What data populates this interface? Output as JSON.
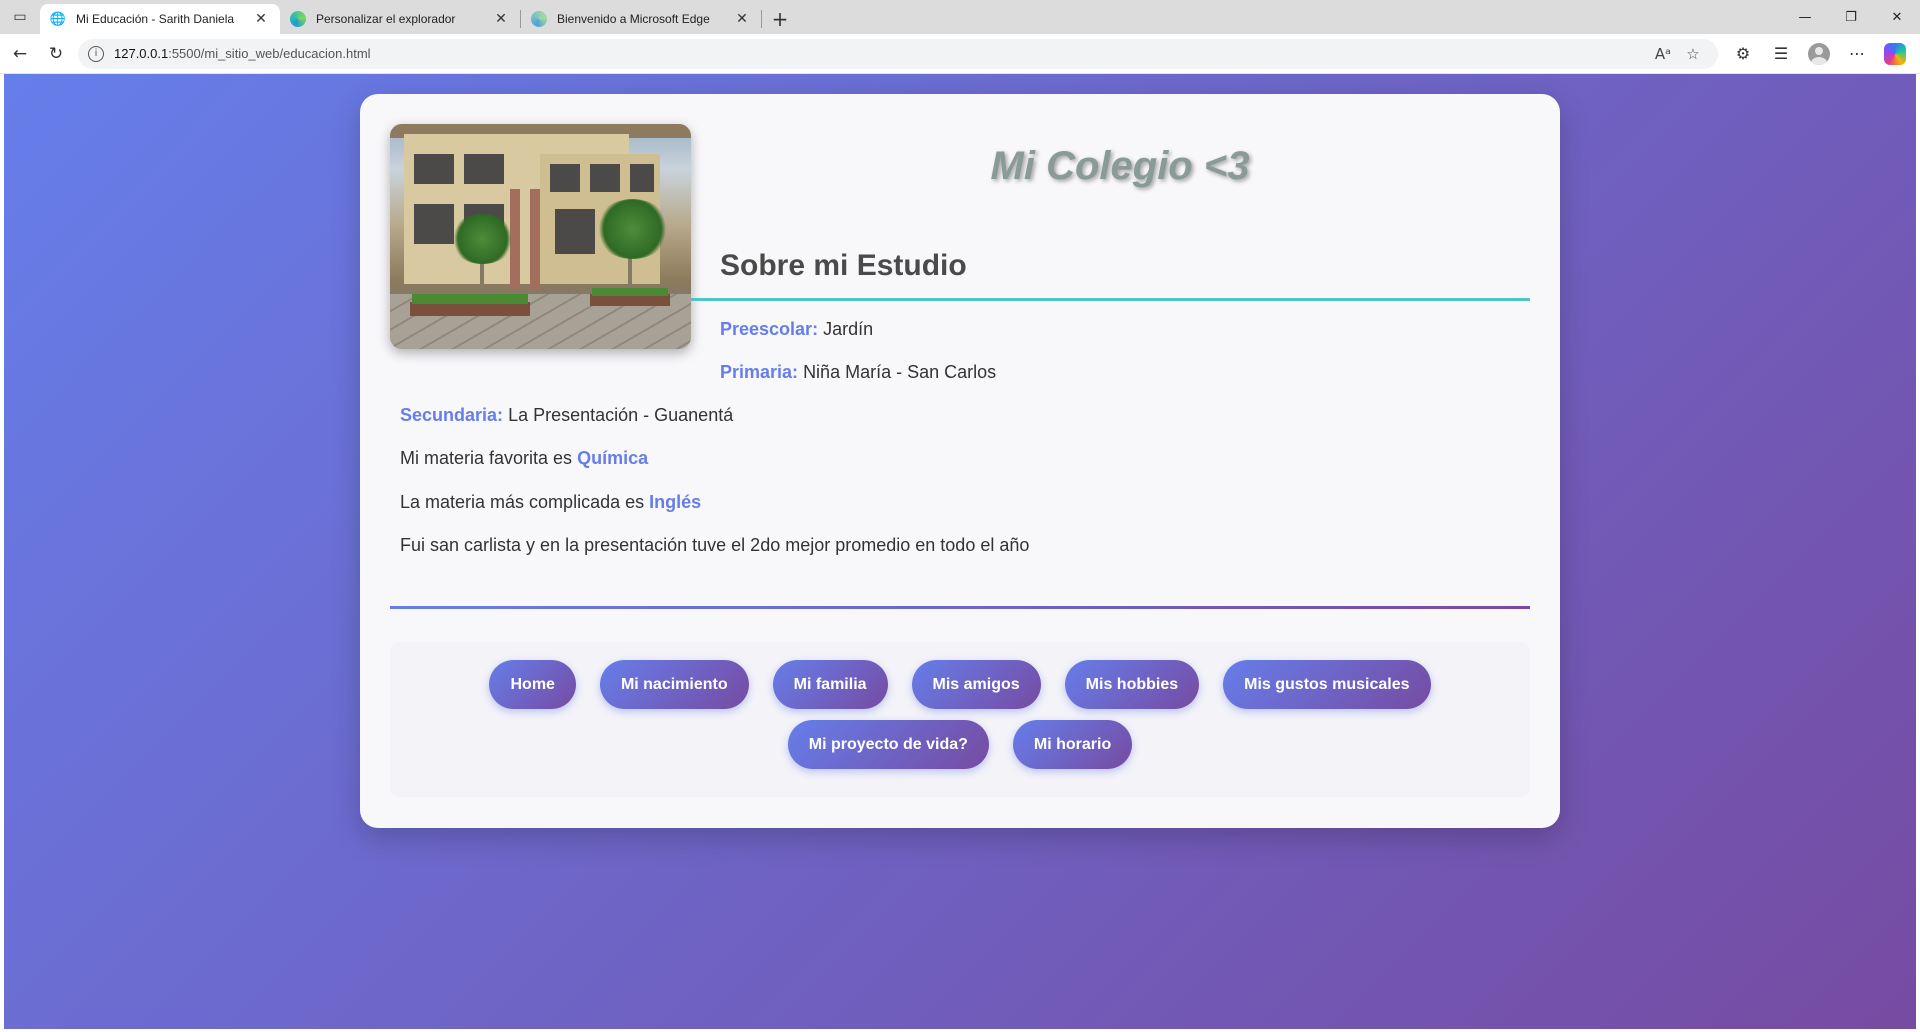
{
  "browser": {
    "tabs": [
      {
        "title": "Mi Educación - Sarith Daniela",
        "close": "✕"
      },
      {
        "title": "Personalizar el explorador",
        "close": "✕"
      },
      {
        "title": "Bienvenido a Microsoft Edge",
        "close": "✕"
      }
    ],
    "new_tab_icon": "+",
    "url_host": "127.0.0.1",
    "url_path": ":5500/mi_sitio_web/educacion.html",
    "icons": [
      "tab-actions-icon",
      "globe-icon",
      "edge-icon",
      "back-icon",
      "reload-icon",
      "info-icon",
      "read-aloud-icon",
      "star-icon",
      "extensions-icon",
      "favorites-icon",
      "profile-icon",
      "more-icon",
      "copilot-icon",
      "minimize-icon",
      "restore-icon",
      "close-window-icon"
    ]
  },
  "page": {
    "title": "Mi Colegio <3",
    "section_title": "Sobre mi Estudio",
    "items": {
      "preescolar_label": "Preescolar:",
      "preescolar_value": "Jardín",
      "primaria_label": "Primaria:",
      "primaria_value": "Niña María - San Carlos",
      "secundaria_label": "Secundaria:",
      "secundaria_value": "La Presentación - Guanentá",
      "favorita_text": "Mi materia favorita es",
      "favorita_value": "Química",
      "complicada_text": "La materia más complicada es",
      "complicada_value": "Inglés",
      "promedio_text": "Fui san carlista y en la presentación tuve el 2do mejor promedio en todo el año"
    },
    "nav": [
      "Home",
      "Mi nacimiento",
      "Mi familia",
      "Mis amigos",
      "Mis hobbies",
      "Mis gustos musicales",
      "Mi proyecto de vida?",
      "Mi horario"
    ]
  },
  "colors": {
    "gradient_start": "#667eea",
    "gradient_end": "#764ba2",
    "section_line": "#4fc7c0",
    "title_gray": "#8a9a96"
  }
}
